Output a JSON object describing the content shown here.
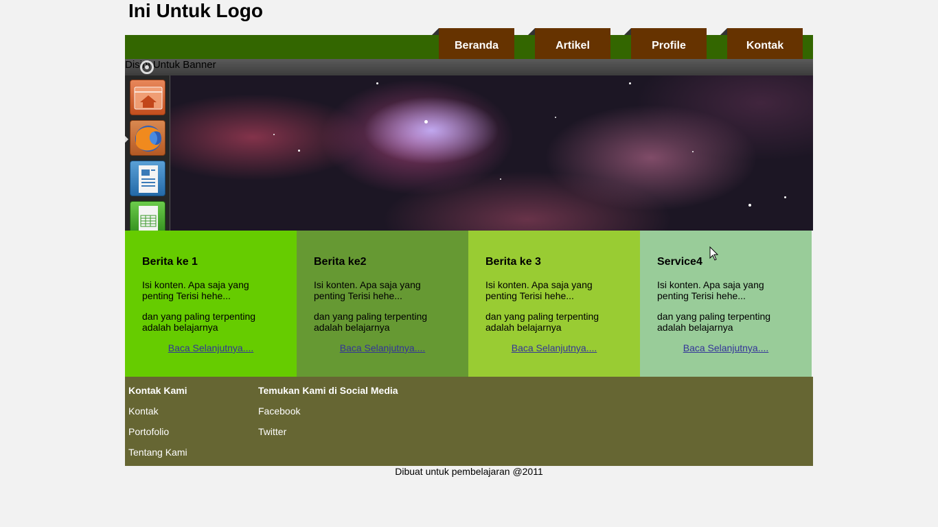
{
  "header": {
    "logo": "Ini Untuk Logo"
  },
  "nav": {
    "items": [
      {
        "label": "Beranda"
      },
      {
        "label": "Artikel"
      },
      {
        "label": "Profile"
      },
      {
        "label": "Kontak"
      }
    ],
    "bar_color": "#336600",
    "tab_color": "#663300"
  },
  "banner": {
    "label": "Disini Untuk Banner",
    "launcher_icons": [
      "home-folder-icon",
      "firefox-icon",
      "writer-document-icon",
      "spreadsheet-icon"
    ]
  },
  "news": [
    {
      "title": "Berita ke 1",
      "body1": "Isi konten. Apa saja yang penting Terisi hehe...",
      "body2": "dan yang paling terpenting adalah belajarnya",
      "link": "Baca Selanjutnya....",
      "color": "#66cc00"
    },
    {
      "title": "Berita ke2",
      "body1": "Isi konten. Apa saja yang penting Terisi hehe...",
      "body2": "dan yang paling terpenting adalah belajarnya",
      "link": "Baca Selanjutnya....",
      "color": "#669933"
    },
    {
      "title": "Berita ke 3",
      "body1": "Isi konten. Apa saja yang penting Terisi hehe...",
      "body2": "dan yang paling terpenting adalah belajarnya",
      "link": "Baca Selanjutnya....",
      "color": "#99cc33"
    },
    {
      "title": "Service4",
      "body1": "Isi konten. Apa saja yang penting Terisi hehe...",
      "body2": "dan yang paling terpenting adalah belajarnya",
      "link": "Baca Selanjutnya....",
      "color": "#99cc99"
    }
  ],
  "footer": {
    "contact": {
      "title": "Kontak Kami",
      "links": [
        "Kontak",
        "Portofolio",
        "Tentang Kami"
      ]
    },
    "social": {
      "title": "Temukan Kami di Social Media",
      "links": [
        "Facebook",
        "Twitter"
      ]
    },
    "color": "#666633"
  },
  "credit": "Dibuat untuk pembelajaran @2011"
}
